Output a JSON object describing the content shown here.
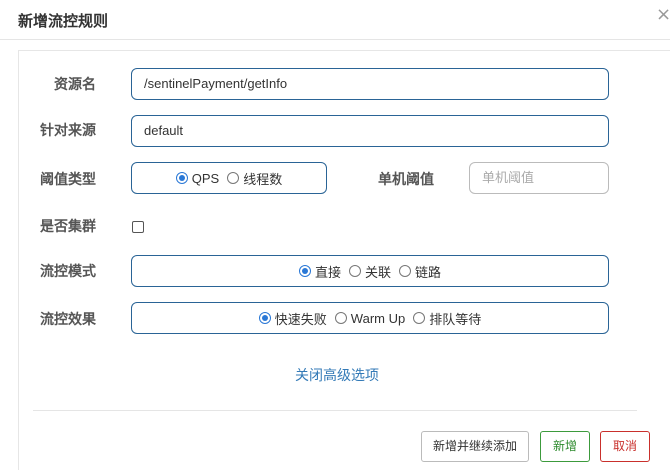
{
  "dialog": {
    "title": "新增流控规则",
    "close_icon": "close-icon"
  },
  "form": {
    "resource_name": {
      "label": "资源名",
      "value": "/sentinelPayment/getInfo"
    },
    "limit_app": {
      "label": "针对来源",
      "value": "default"
    },
    "threshold_type": {
      "label": "阈值类型",
      "options": [
        "QPS",
        "线程数"
      ],
      "selected": "QPS"
    },
    "single_threshold": {
      "label": "单机阈值",
      "placeholder": "单机阈值",
      "value": ""
    },
    "cluster_mode": {
      "label": "是否集群",
      "checked": false
    },
    "control_mode": {
      "label": "流控模式",
      "options": [
        "直接",
        "关联",
        "链路"
      ],
      "selected": "直接"
    },
    "control_effect": {
      "label": "流控效果",
      "options": [
        "快速失败",
        "Warm Up",
        "排队等待"
      ],
      "selected": "快速失败"
    },
    "advanced_link": "关闭高级选项"
  },
  "footer": {
    "add_continue": "新增并继续添加",
    "add": "新增",
    "cancel": "取消"
  },
  "colors": {
    "primary_border": "#2a6496",
    "link": "#337ab7",
    "success": "#2d8a2d",
    "danger": "#c9302c"
  }
}
